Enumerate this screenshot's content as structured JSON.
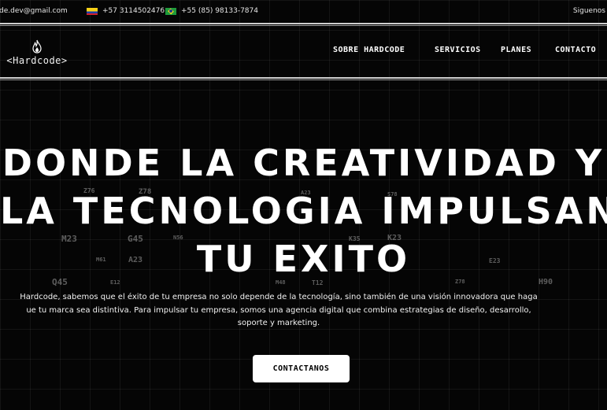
{
  "topbar": {
    "email": "de.dev@gmail.com",
    "phone_co": "+57 3114502476",
    "phone_br": "+55 (85) 98133-7874",
    "follow_label": "Siguenos",
    "flag_co_icon": "colombia-flag-icon",
    "flag_br_icon": "brazil-flag-icon"
  },
  "header": {
    "logo_text": "<Hardcode>",
    "logo_icon": "flame-icon",
    "nav": [
      "SOBRE HARDCODE",
      "SERVICIOS",
      "PLANES",
      "CONTACTO"
    ]
  },
  "hero": {
    "title_lines": [
      "DONDE LA CREATIVIDAD Y",
      "LA TECNOLOGIA IMPULSAN",
      "TU EXITO"
    ],
    "paragraph_lines": [
      "Hardcode, sabemos que el éxito de tu empresa no solo depende de la tecnología, sino también de una visión innovadora que haga",
      "ue tu marca sea distintiva. Para impulsar tu empresa, somos una agencia digital que combina estrategias de diseño, desarrollo,",
      "soporte y marketing."
    ],
    "cta_label": "CONTACTANOS"
  },
  "background_codes": [
    "Z76",
    "Z78",
    "Q45",
    "M23",
    "G45",
    "K23",
    "H90",
    "A23",
    "M61",
    "E23",
    "K35",
    "S78",
    "M48",
    "T12",
    "Z78",
    "N56",
    "E12",
    "A23"
  ],
  "colors": {
    "background": "#050505",
    "text": "#ffffff",
    "cta_background": "#ffffff",
    "cta_text": "#000000",
    "divider": "#cfcfcf"
  }
}
